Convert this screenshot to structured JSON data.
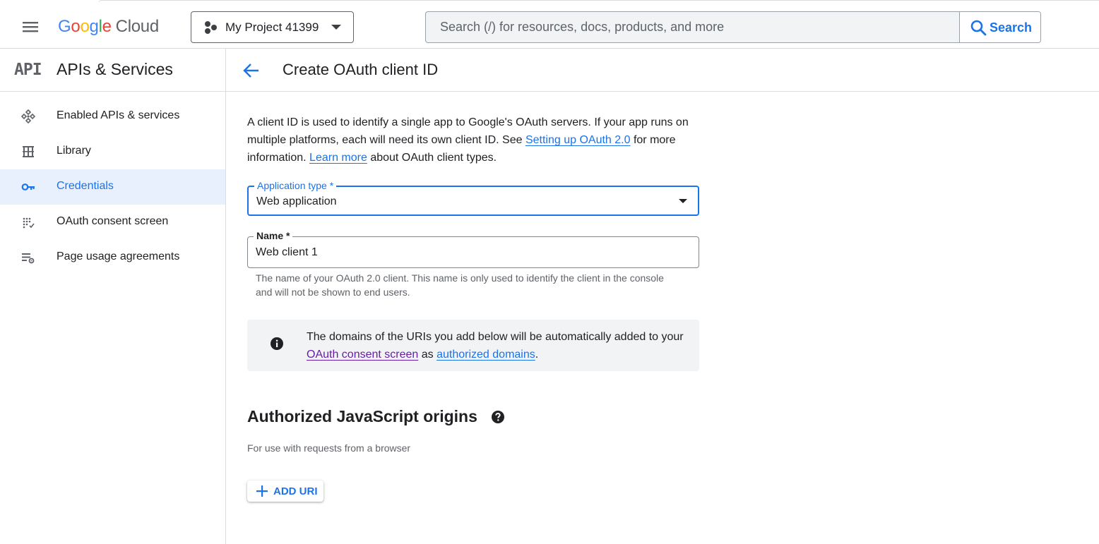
{
  "header": {
    "logo_google": "Google",
    "logo_cloud": "Cloud",
    "project_name": "My Project 41399",
    "search_placeholder": "Search (/) for resources, docs, products, and more",
    "search_button": "Search"
  },
  "sidebar": {
    "badge": "API",
    "title": "APIs & Services",
    "items": [
      {
        "label": "Enabled APIs & services",
        "icon": "enabled-apis-icon",
        "active": false
      },
      {
        "label": "Library",
        "icon": "library-icon",
        "active": false
      },
      {
        "label": "Credentials",
        "icon": "key-icon",
        "active": true
      },
      {
        "label": "OAuth consent screen",
        "icon": "consent-icon",
        "active": false
      },
      {
        "label": "Page usage agreements",
        "icon": "agreements-icon",
        "active": false
      }
    ]
  },
  "page": {
    "title": "Create OAuth client ID",
    "intro_1": "A client ID is used to identify a single app to Google's OAuth servers. If your app runs on multiple platforms, each will need its own client ID. See ",
    "intro_link_1": "Setting up OAuth 2.0",
    "intro_2": " for more information. ",
    "intro_link_2": "Learn more",
    "intro_3": " about OAuth client types.",
    "app_type_label": "Application type *",
    "app_type_value": "Web application",
    "name_label": "Name *",
    "name_value": "Web client 1",
    "name_hint": "The name of your OAuth 2.0 client. This name is only used to identify the client in the console and will not be shown to end users.",
    "info_1": "The domains of the URIs you add below will be automatically added to your ",
    "info_link_1": "OAuth consent screen",
    "info_2": " as ",
    "info_link_2": "authorized domains",
    "info_3": ".",
    "js_origins_title": "Authorized JavaScript origins",
    "js_origins_sub": "For use with requests from a browser",
    "add_uri": "ADD URI"
  },
  "colors": {
    "accent": "#1a73e8",
    "visited_link": "#681da8",
    "active_bg": "#e8f0fe",
    "info_bg": "#f1f3f4"
  }
}
